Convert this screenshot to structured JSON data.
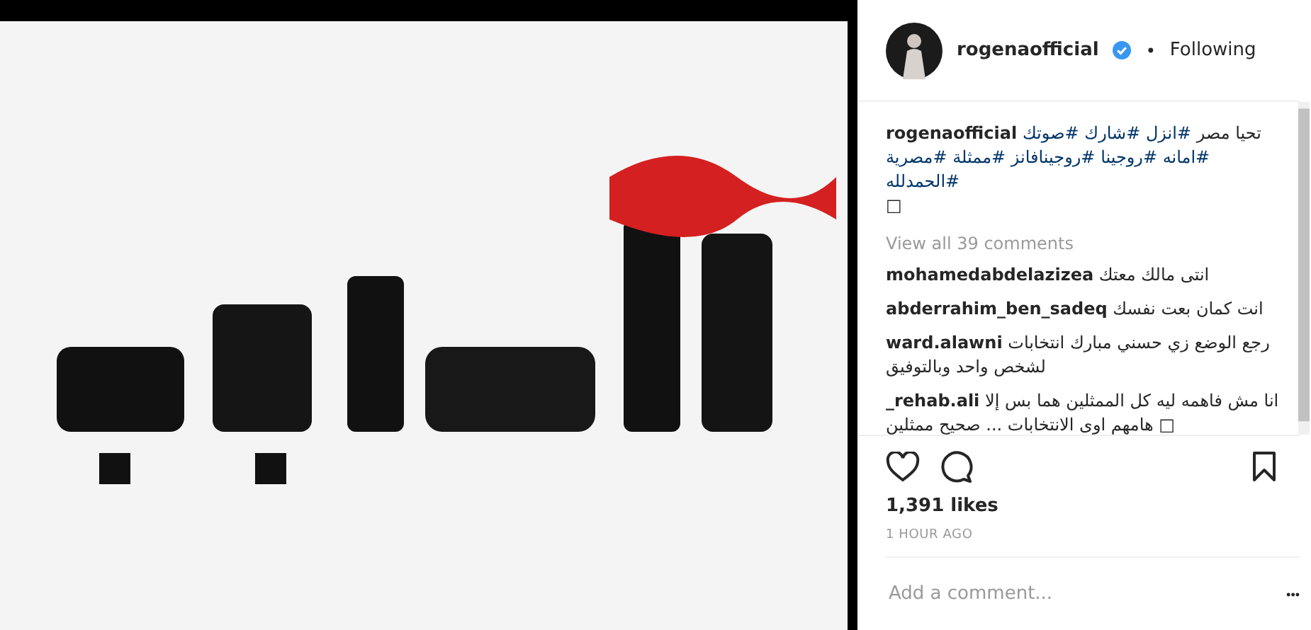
{
  "header": {
    "username": "rogenaofficial",
    "verified": true,
    "separator": "•",
    "follow": "Following"
  },
  "caption": {
    "username": "rogenaofficial",
    "text": "تحيا مصر",
    "hashtags": [
      "#انزل",
      "#شارك",
      "#صوتك",
      "#امانه",
      "#روجينا",
      "#روجينافانز",
      "#ممثلة",
      "#مصرية",
      "#الحمدلله"
    ],
    "trailing": "□"
  },
  "view_all": "View all 39 comments",
  "comments": [
    {
      "username": "mohamedabdelazizea",
      "text": "انتى مالك معتك"
    },
    {
      "username": "abderrahim_ben_sadeq",
      "text": "انت كمان بعت نفسك"
    },
    {
      "username": "ward.alawni",
      "text": "رجع الوضع زي حسني مبارك انتخابات لشخص واحد وبالتوفيق"
    },
    {
      "username": "_rehab.ali",
      "text": "انا مش فاهمه ليه كل الممثلين هما بس إلا هامهم اوى الانتخابات ... صحيح ممثلين □"
    }
  ],
  "likes": "1,391 likes",
  "time": "1 HOUR AGO",
  "comment_field": {
    "placeholder": "Add a comment..."
  },
  "more": "•••"
}
